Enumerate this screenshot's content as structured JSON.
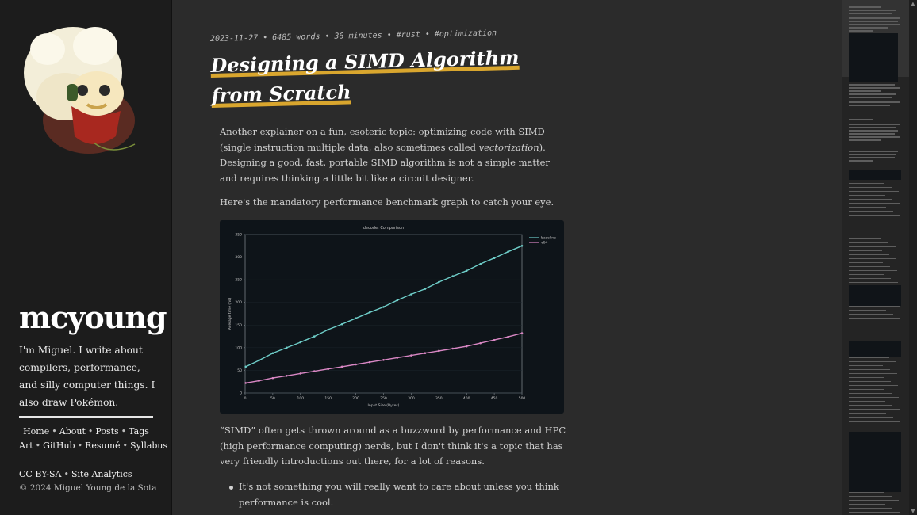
{
  "sidebar": {
    "site_name": "mcyoung",
    "bio": "I'm Miguel. I write about compilers, performance, and silly computer things. I also draw Pokémon.",
    "nav_row1": [
      "Home",
      "About",
      "Posts",
      "Tags"
    ],
    "nav_row2": [
      "Art",
      "GitHub",
      "Resumé",
      "Syllabus"
    ],
    "footer_links": [
      "CC BY-SA",
      "Site Analytics"
    ],
    "copyright": "© 2024 Miguel Young de la Sota"
  },
  "article": {
    "date": "2023-11-27",
    "words": "6485 words",
    "read_time": "36 minutes",
    "tags": [
      "#rust",
      "#optimization"
    ],
    "title_line1": "Designing a SIMD Algorithm",
    "title_line2": "from Scratch",
    "p1_a": "Another explainer on a fun, esoteric topic: optimizing code with SIMD (single instruction multiple data, also sometimes called ",
    "p1_em": "vectorization",
    "p1_b": "). Designing a good, fast, portable SIMD algorithm is not a simple matter and requires thinking a little bit like a circuit designer.",
    "p2": "Here's the mandatory performance benchmark graph to catch your eye.",
    "p3": "“SIMD” often gets thrown around as a buzzword by performance and HPC (high performance computing) nerds, but I don't think it's a topic that has very friendly introductions out there, for a lot of reasons.",
    "bullet1": "It's not something you will really want to care about unless you think performance is cool."
  },
  "chart_data": {
    "type": "line",
    "title": "decode: Comparison",
    "xlabel": "Input Size (Bytes)",
    "ylabel": "Average time (ns)",
    "xlim": [
      0,
      500
    ],
    "ylim": [
      0,
      350
    ],
    "xticks": [
      "0",
      "50",
      "100",
      "150",
      "200",
      "250",
      "300",
      "350",
      "400",
      "450",
      "500"
    ],
    "yticks": [
      "0",
      "50",
      "100",
      "150",
      "200",
      "250",
      "300",
      "350"
    ],
    "legend_position": "top-right",
    "series": [
      {
        "name": "baseline",
        "color": "#6ecdc8",
        "x": [
          1,
          25,
          50,
          75,
          100,
          125,
          150,
          175,
          200,
          225,
          250,
          275,
          300,
          325,
          350,
          375,
          400,
          425,
          450,
          475,
          500
        ],
        "values": [
          58,
          72,
          88,
          100,
          112,
          125,
          140,
          152,
          165,
          178,
          190,
          205,
          218,
          230,
          245,
          258,
          270,
          285,
          298,
          312,
          325
        ]
      },
      {
        "name": "v64",
        "color": "#d987c4",
        "x": [
          1,
          25,
          50,
          75,
          100,
          125,
          150,
          175,
          200,
          225,
          250,
          275,
          300,
          325,
          350,
          375,
          400,
          425,
          450,
          475,
          500
        ],
        "values": [
          22,
          27,
          33,
          38,
          43,
          48,
          53,
          58,
          63,
          68,
          73,
          78,
          83,
          88,
          93,
          98,
          103,
          110,
          117,
          124,
          132
        ]
      }
    ]
  },
  "colors": {
    "accent": "#d9a62e",
    "background": "#2b2b2b",
    "sidebar": "#1c1c1c"
  }
}
